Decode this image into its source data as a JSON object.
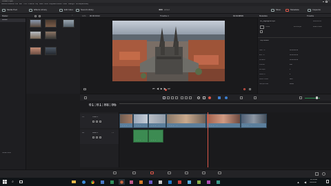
{
  "app": {
    "title": "Untitled Project"
  },
  "menu": [
    "DaVinci Resolve",
    "File",
    "Edit",
    "Trim",
    "Timeline",
    "Clip",
    "Mark",
    "View",
    "Playback",
    "Fusion",
    "Color",
    "Fairlight",
    "Workspace",
    "Help"
  ],
  "toolbar": {
    "media_pool": "Media Pool",
    "effects_library": "Effects Library",
    "edit_index": "Edit Index",
    "sound_library": "Sound Library",
    "project_name": "4K8",
    "edited": "Edited",
    "mixer": "Mixer",
    "metadata": "Metadata",
    "inspector": "Inspector"
  },
  "media_pool": {
    "master": "Master",
    "smart_bins": "Smart Bins",
    "clips": [
      "",
      "",
      "",
      "",
      "",
      "",
      ""
    ]
  },
  "viewer": {
    "zoom": "12%",
    "timecode": "00:00:03:02",
    "timeline_name": "Timeline 1",
    "current_timecode": "01:01:08:06"
  },
  "metadata": {
    "header": "Metadata",
    "tab_timeline": "Timeline",
    "clip_name": "4K_Highlights.mp4",
    "date": "2020-06-09",
    "codec": "H.264",
    "fps": "23.976 fps",
    "resolution": "4096 x 2160",
    "clip_details": "Clip Details",
    "fields": [
      {
        "label": "Start TC",
        "value": "00:00:00:00"
      },
      {
        "label": "End TC",
        "value": "00:00:10:00"
      },
      {
        "label": "Duration",
        "value": "00:00:10:00"
      },
      {
        "label": "Frames",
        "value": "240"
      },
      {
        "label": "Bit Depth",
        "value": "8"
      },
      {
        "label": "Audio Ch",
        "value": "2"
      },
      {
        "label": "Audio Codec",
        "value": "AAC"
      },
      {
        "label": "Sample Rate",
        "value": "48000"
      }
    ]
  },
  "timeline": {
    "timecode": "01:01:08:06",
    "video_track": "Video 1",
    "audio_track": "Audio 1",
    "audio_level": "2.0",
    "video_clips": [
      "4K_Highlights.mp4",
      "4K_Highlights.mp4",
      "4K_Highlights.mp4",
      "4K_Highlights.mp4",
      "4K_Highlights.mp4",
      "4K_Highlights.mp4"
    ],
    "audio_clips": [
      "4K_Highlights.mp4",
      "4K_Highlights.mp4"
    ]
  },
  "pages": [
    "Media",
    "Cut",
    "Edit",
    "Fusion",
    "Color",
    "Fairlight",
    "Deliver"
  ],
  "active_page": "Edit",
  "footer": {
    "app_label": "DaVinci Resolve 15"
  },
  "taskbar": {
    "time": "11:31 AM",
    "date": "6/11/2020"
  },
  "colors": {
    "accent": "#e0584a",
    "clip_video": "#5c7f9c",
    "clip_audio": "#3c8b52",
    "timecode": "#e6e6ea"
  }
}
